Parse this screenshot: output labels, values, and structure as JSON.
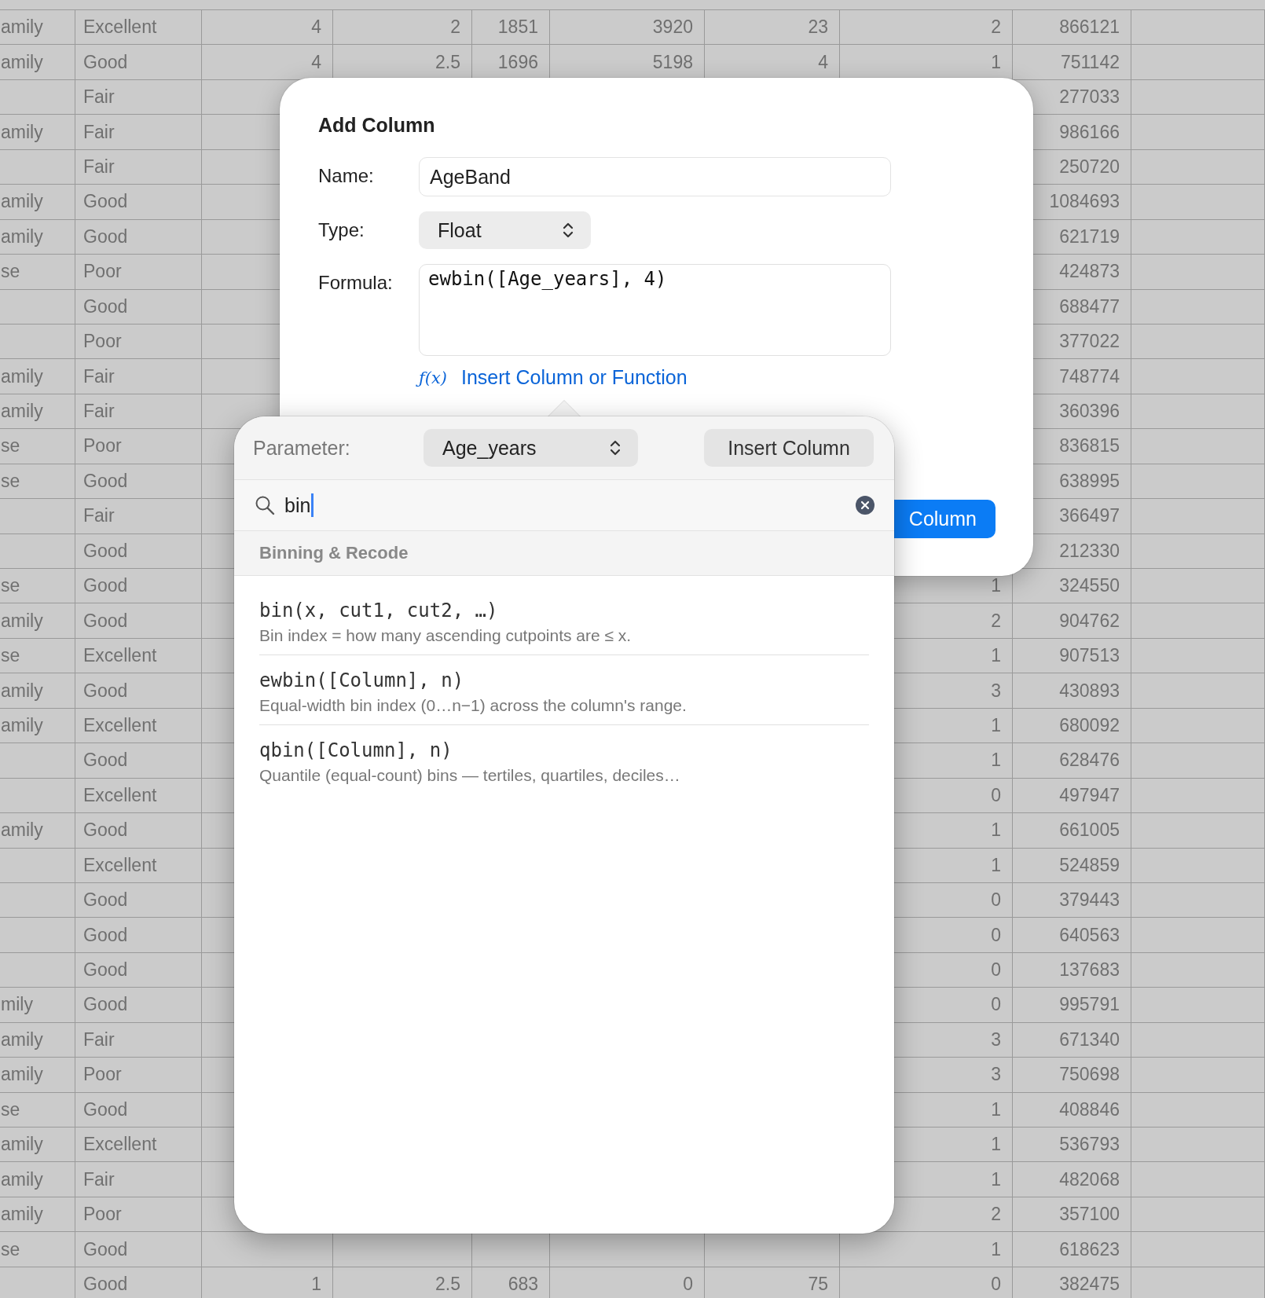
{
  "table": {
    "rows": [
      {
        "cells": [
          "amily",
          "Excellent",
          "4",
          "2",
          "1851",
          "3920",
          "23",
          "2",
          "866121"
        ]
      },
      {
        "cells": [
          "amily",
          "Good",
          "4",
          "2.5",
          "1696",
          "5198",
          "4",
          "1",
          "751142"
        ]
      },
      {
        "cells": [
          null,
          "Fair",
          null,
          null,
          null,
          null,
          null,
          null,
          "277033"
        ]
      },
      {
        "cells": [
          "amily",
          "Fair",
          null,
          null,
          null,
          null,
          null,
          null,
          "986166"
        ]
      },
      {
        "cells": [
          null,
          "Fair",
          null,
          null,
          null,
          null,
          null,
          null,
          "250720"
        ]
      },
      {
        "cells": [
          "amily",
          "Good",
          null,
          null,
          null,
          null,
          null,
          null,
          "1084693"
        ]
      },
      {
        "cells": [
          "amily",
          "Good",
          null,
          null,
          null,
          null,
          null,
          null,
          "621719"
        ]
      },
      {
        "cells": [
          "se",
          "Poor",
          null,
          null,
          null,
          null,
          null,
          null,
          "424873"
        ]
      },
      {
        "cells": [
          null,
          "Good",
          null,
          null,
          null,
          null,
          null,
          null,
          "688477"
        ]
      },
      {
        "cells": [
          null,
          "Poor",
          null,
          null,
          null,
          null,
          null,
          null,
          "377022"
        ]
      },
      {
        "cells": [
          "amily",
          "Fair",
          null,
          null,
          null,
          null,
          null,
          null,
          "748774"
        ]
      },
      {
        "cells": [
          "amily",
          "Fair",
          null,
          null,
          null,
          null,
          null,
          null,
          "360396"
        ]
      },
      {
        "cells": [
          "se",
          "Poor",
          null,
          null,
          null,
          null,
          null,
          null,
          "836815"
        ]
      },
      {
        "cells": [
          "se",
          "Good",
          null,
          null,
          null,
          null,
          null,
          null,
          "638995"
        ]
      },
      {
        "cells": [
          null,
          "Fair",
          null,
          null,
          null,
          null,
          null,
          null,
          "366497"
        ]
      },
      {
        "cells": [
          null,
          "Good",
          null,
          null,
          null,
          null,
          null,
          null,
          "212330"
        ]
      },
      {
        "cells": [
          "se",
          "Good",
          null,
          null,
          null,
          null,
          null,
          "1",
          "324550"
        ]
      },
      {
        "cells": [
          "amily",
          "Good",
          null,
          null,
          null,
          null,
          null,
          "2",
          "904762"
        ]
      },
      {
        "cells": [
          "se",
          "Excellent",
          null,
          null,
          null,
          null,
          null,
          "1",
          "907513"
        ]
      },
      {
        "cells": [
          "amily",
          "Good",
          null,
          null,
          null,
          null,
          null,
          "3",
          "430893"
        ]
      },
      {
        "cells": [
          "amily",
          "Excellent",
          null,
          null,
          null,
          null,
          null,
          "1",
          "680092"
        ]
      },
      {
        "cells": [
          null,
          "Good",
          null,
          null,
          null,
          null,
          null,
          "1",
          "628476"
        ]
      },
      {
        "cells": [
          null,
          "Excellent",
          null,
          null,
          null,
          null,
          null,
          "0",
          "497947"
        ]
      },
      {
        "cells": [
          "amily",
          "Good",
          null,
          null,
          null,
          null,
          null,
          "1",
          "661005"
        ]
      },
      {
        "cells": [
          null,
          "Excellent",
          null,
          null,
          null,
          null,
          null,
          "1",
          "524859"
        ]
      },
      {
        "cells": [
          null,
          "Good",
          null,
          null,
          null,
          null,
          null,
          "0",
          "379443"
        ]
      },
      {
        "cells": [
          null,
          "Good",
          null,
          null,
          null,
          null,
          null,
          "0",
          "640563"
        ]
      },
      {
        "cells": [
          null,
          "Good",
          null,
          null,
          null,
          null,
          null,
          "0",
          "137683"
        ]
      },
      {
        "cells": [
          "mily",
          "Good",
          null,
          null,
          null,
          null,
          null,
          "0",
          "995791"
        ]
      },
      {
        "cells": [
          "amily",
          "Fair",
          null,
          null,
          null,
          null,
          null,
          "3",
          "671340"
        ]
      },
      {
        "cells": [
          "amily",
          "Poor",
          null,
          null,
          null,
          null,
          null,
          "3",
          "750698"
        ]
      },
      {
        "cells": [
          "se",
          "Good",
          null,
          null,
          null,
          null,
          null,
          "1",
          "408846"
        ]
      },
      {
        "cells": [
          "amily",
          "Excellent",
          null,
          null,
          null,
          null,
          null,
          "1",
          "536793"
        ]
      },
      {
        "cells": [
          "amily",
          "Fair",
          null,
          null,
          null,
          null,
          null,
          "1",
          "482068"
        ]
      },
      {
        "cells": [
          "amily",
          "Poor",
          null,
          null,
          null,
          null,
          null,
          "2",
          "357100"
        ]
      },
      {
        "cells": [
          "se",
          "Good",
          null,
          null,
          null,
          null,
          null,
          "1",
          "618623"
        ]
      },
      {
        "cells": [
          null,
          "Good",
          "1",
          "2.5",
          "683",
          "0",
          "75",
          "0",
          "382475"
        ]
      }
    ]
  },
  "dialog": {
    "title": "Add Column",
    "fields": [
      {
        "kind": "text",
        "label": "Name:",
        "value": "AgeBand"
      },
      {
        "kind": "popup",
        "label": "Type:",
        "value": "Float"
      },
      {
        "kind": "textarea",
        "label": "Formula:",
        "value": "ewbin([Age_years], 4)"
      }
    ],
    "insert_link": {
      "icon": "ƒ(x)",
      "label": "Insert Column or Function"
    },
    "primary_button": "Column"
  },
  "popover": {
    "parameter_label": "Parameter:",
    "parameter_value": "Age_years",
    "insert_button": "Insert Column",
    "search": {
      "value": "bin"
    },
    "section": "Binning & Recode",
    "functions": [
      {
        "signature": "bin(x, cut1, cut2, …)",
        "description": "Bin index = how many ascending cutpoints are ≤ x."
      },
      {
        "signature": "ewbin([Column], n)",
        "description": "Equal-width bin index (0…n−1) across the column's range."
      },
      {
        "signature": "qbin([Column], n)",
        "description": "Quantile (equal-count) bins — tertiles, quartiles, deciles…"
      }
    ]
  }
}
